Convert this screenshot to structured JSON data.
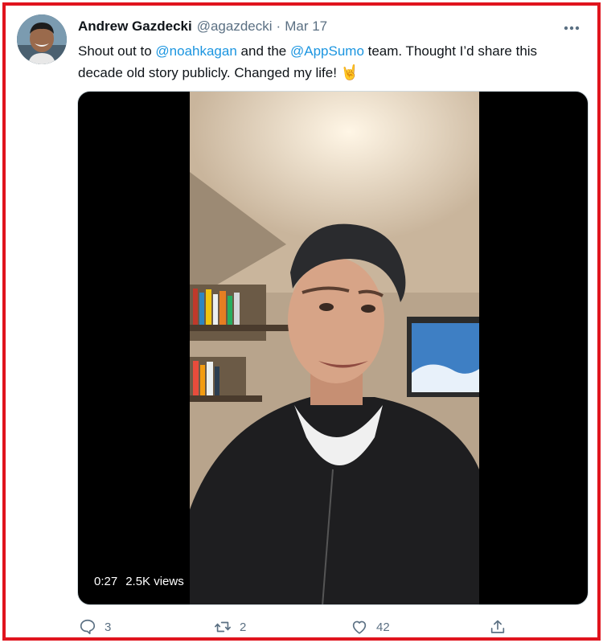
{
  "tweet": {
    "author_name": "Andrew Gazdecki",
    "handle": "@agazdecki",
    "separator": "·",
    "date": "Mar 17",
    "text_parts": {
      "p1": "Shout out to ",
      "mention1": "@noahkagan",
      "p2": " and the ",
      "mention2": "@AppSumo",
      "p3": " team. Thought I’d share this decade old story publicly. Changed my life! ",
      "emoji": "🤘"
    },
    "avatar_icon": "profile-photo",
    "more_icon": "ellipsis-icon"
  },
  "video": {
    "duration": "0:27",
    "views": "2.5K views"
  },
  "actions": {
    "reply_count": "3",
    "retweet_count": "2",
    "like_count": "42"
  },
  "colors": {
    "frame_border": "#e0141e",
    "link": "#1b95e0",
    "muted": "#5b7083"
  }
}
